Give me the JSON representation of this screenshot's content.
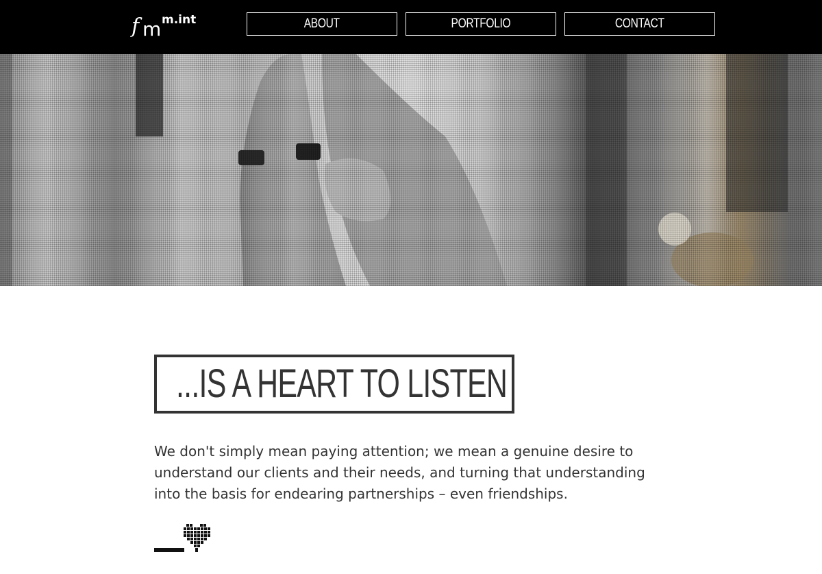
{
  "header": {
    "logo": {
      "f": "f",
      "m": "m",
      "sup": "m.int"
    },
    "nav": [
      {
        "label": "ABOUT"
      },
      {
        "label": "PORTFOLIO"
      },
      {
        "label": "CONTACT"
      }
    ]
  },
  "hero": {
    "image": "hands-with-rings-photo"
  },
  "main": {
    "heading": "...IS A HEART TO LISTEN",
    "paragraph": "We don't simply mean paying attention; we mean a genuine desire to understand our clients and their needs, and turning that understanding into the basis for endearing partnerships – even friendships."
  },
  "colors": {
    "header_bg": "#000000",
    "text": "#333333",
    "accent": "#111111"
  },
  "icons": {
    "divider": "pixel-heart-icon"
  }
}
